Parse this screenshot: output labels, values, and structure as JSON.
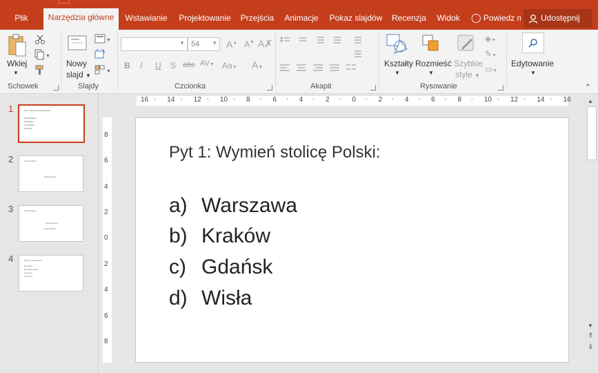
{
  "tabs": [
    {
      "label": "Plik",
      "active": false
    },
    {
      "label": "Narzędzia główne",
      "active": true
    },
    {
      "label": "Wstawianie",
      "active": false
    },
    {
      "label": "Projektowanie",
      "active": false
    },
    {
      "label": "Przejścia",
      "active": false
    },
    {
      "label": "Animacje",
      "active": false
    },
    {
      "label": "Pokaz slajdów",
      "active": false
    },
    {
      "label": "Recenzja",
      "active": false
    },
    {
      "label": "Widok",
      "active": false
    }
  ],
  "tell_me": "Powiedz m",
  "share_label": "Udostępnij",
  "ribbon": {
    "clipboard": {
      "paste": "Wklej",
      "group": "Schowek"
    },
    "slides": {
      "new_slide_1": "Nowy",
      "new_slide_2": "slajd",
      "group": "Slajdy"
    },
    "font": {
      "font_name": "",
      "font_size": "54",
      "bold": "B",
      "italic": "I",
      "underline": "U",
      "shadow": "S",
      "strike": "abc",
      "spacing": "AV",
      "case": "Aa",
      "color": "A",
      "group": "Czcionka"
    },
    "paragraph": {
      "group": "Akapit"
    },
    "drawing": {
      "shapes": "Kształty",
      "arrange": "Rozmieść",
      "quick_1": "Szybkie",
      "quick_2": "style",
      "group": "Rysowanie"
    },
    "editing": {
      "label": "Edytowanie"
    }
  },
  "thumbnails": [
    {
      "number": "1",
      "title": "Pyt 1: Wymień stolicę Polski:",
      "lines": [
        "a)  Warszawa",
        "b)  Kraków",
        "c)  Gdańsk",
        "d)  Wisła"
      ],
      "center": ""
    },
    {
      "number": "2",
      "title": "Lorem ipsum",
      "lines": [],
      "center": "Lorem ipsum"
    },
    {
      "number": "3",
      "title": "Lorem ipsum",
      "lines": [],
      "center": "Lorem ipsum"
    },
    {
      "number": "4",
      "title": "Pyt 2: Lorem ipsum",
      "lines": [
        "a)  Lorem",
        "b)  Lorem ipsum",
        "c)  Lorem",
        "d)  Lorem"
      ],
      "center": ""
    }
  ],
  "hruler_labels": [
    "16",
    "14",
    "12",
    "10",
    "8",
    "6",
    "4",
    "2",
    "0",
    "2",
    "4",
    "6",
    "8",
    "10",
    "12",
    "14",
    "16"
  ],
  "vruler_labels": [
    "8",
    "6",
    "4",
    "2",
    "0",
    "2",
    "4",
    "6",
    "8"
  ],
  "slide": {
    "question": "Pyt 1: Wymień stolicę Polski:",
    "options": [
      {
        "letter": "a)",
        "text": "Warszawa"
      },
      {
        "letter": "b)",
        "text": "Kraków"
      },
      {
        "letter": "c)",
        "text": "Gdańsk"
      },
      {
        "letter": "d)",
        "text": "Wisła"
      }
    ]
  },
  "colors": {
    "accent": "#c43e1c",
    "share_bg": "#a83518",
    "ribbon_bg": "#f3f3f3",
    "workspace": "#e6e6e6"
  }
}
